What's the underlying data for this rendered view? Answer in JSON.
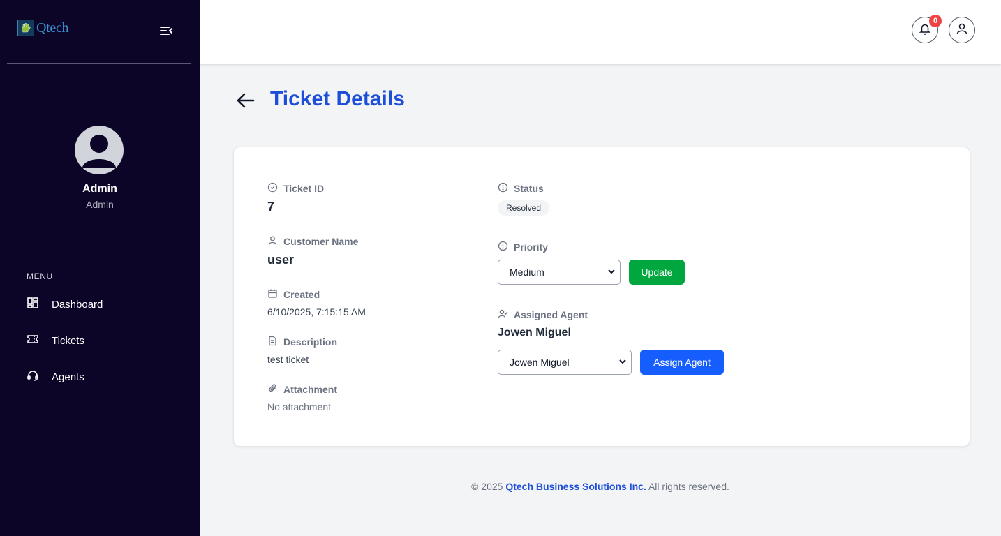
{
  "brand": {
    "name": "Qtech"
  },
  "sidebar": {
    "user_name": "Admin",
    "user_role": "Admin",
    "menu_label": "MENU",
    "items": [
      {
        "label": "Dashboard",
        "icon": "dashboard-icon"
      },
      {
        "label": "Tickets",
        "icon": "ticket-icon"
      },
      {
        "label": "Agents",
        "icon": "headset-icon"
      }
    ]
  },
  "topbar": {
    "notification_count": "0"
  },
  "page": {
    "title": "Ticket Details"
  },
  "ticket": {
    "id_label": "Ticket ID",
    "id": "7",
    "customer_label": "Customer Name",
    "customer": "user",
    "created_label": "Created",
    "created": "6/10/2025, 7:15:15 AM",
    "description_label": "Description",
    "description": "test ticket",
    "attachment_label": "Attachment",
    "attachment": "No attachment",
    "status_label": "Status",
    "status": "Resolved",
    "priority_label": "Priority",
    "priority_selected": "Medium",
    "update_button": "Update",
    "agent_label": "Assigned Agent",
    "agent": "Jowen Miguel",
    "agent_selected": "Jowen Miguel",
    "assign_button": "Assign Agent"
  },
  "colors": {
    "update_button": "#00a63e",
    "assign_button": "#155dfc",
    "title": "#1d4ed8",
    "sidebar": "#0c0528"
  },
  "footer": {
    "prefix": "© 2025",
    "company": "Qtech Business Solutions Inc.",
    "suffix": "All rights reserved."
  }
}
